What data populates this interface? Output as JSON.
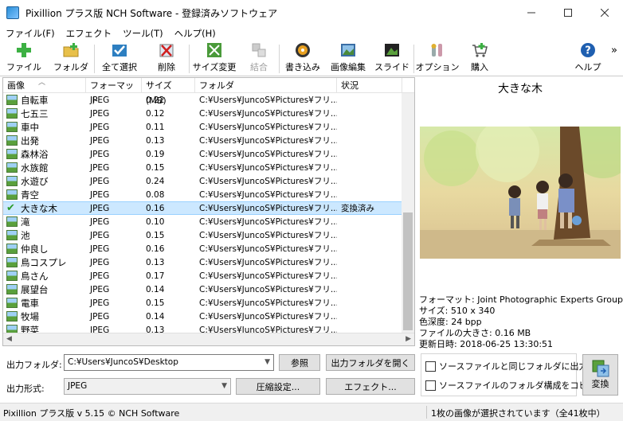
{
  "window": {
    "title": "Pixillion プラス版 NCH Software - 登録済みソフトウェア",
    "minimize_icon": "minimize-icon",
    "maximize_icon": "maximize-icon",
    "close_icon": "close-icon"
  },
  "menu": {
    "items": [
      "ファイル(F)",
      "エフェクト",
      "ツール(T)",
      "ヘルプ(H)"
    ]
  },
  "toolbar": {
    "add_file": "ファイル",
    "add_folder": "フォルダ",
    "select_all": "全て選択",
    "delete": "削除",
    "resize": "サイズ変更",
    "combine": "結合",
    "burn": "書き込み",
    "image_edit": "画像編集",
    "slide": "スライド",
    "options": "オプション",
    "buy": "購入",
    "help": "ヘルプ",
    "more": "»"
  },
  "list": {
    "columns": [
      "画像",
      "フォーマット",
      "サイズ (MB)",
      "フォルダ",
      "状況"
    ],
    "rows": [
      {
        "name": "自転車",
        "format": "JPEG",
        "size": "0.22",
        "folder": "C:¥Users¥JuncoS¥Pictures¥フリ...",
        "status": ""
      },
      {
        "name": "七五三",
        "format": "JPEG",
        "size": "0.12",
        "folder": "C:¥Users¥JuncoS¥Pictures¥フリ...",
        "status": ""
      },
      {
        "name": "車中",
        "format": "JPEG",
        "size": "0.11",
        "folder": "C:¥Users¥JuncoS¥Pictures¥フリ...",
        "status": ""
      },
      {
        "name": "出発",
        "format": "JPEG",
        "size": "0.13",
        "folder": "C:¥Users¥JuncoS¥Pictures¥フリ...",
        "status": ""
      },
      {
        "name": "森林浴",
        "format": "JPEG",
        "size": "0.19",
        "folder": "C:¥Users¥JuncoS¥Pictures¥フリ...",
        "status": ""
      },
      {
        "name": "水族館",
        "format": "JPEG",
        "size": "0.15",
        "folder": "C:¥Users¥JuncoS¥Pictures¥フリ...",
        "status": ""
      },
      {
        "name": "水遊び",
        "format": "JPEG",
        "size": "0.24",
        "folder": "C:¥Users¥JuncoS¥Pictures¥フリ...",
        "status": ""
      },
      {
        "name": "青空",
        "format": "JPEG",
        "size": "0.08",
        "folder": "C:¥Users¥JuncoS¥Pictures¥フリ...",
        "status": ""
      },
      {
        "name": "大きな木",
        "format": "JPEG",
        "size": "0.16",
        "folder": "C:¥Users¥JuncoS¥Pictures¥フリ...",
        "status": "変換済み"
      },
      {
        "name": "滝",
        "format": "JPEG",
        "size": "0.10",
        "folder": "C:¥Users¥JuncoS¥Pictures¥フリ...",
        "status": ""
      },
      {
        "name": "池",
        "format": "JPEG",
        "size": "0.15",
        "folder": "C:¥Users¥JuncoS¥Pictures¥フリ...",
        "status": ""
      },
      {
        "name": "仲良し",
        "format": "JPEG",
        "size": "0.16",
        "folder": "C:¥Users¥JuncoS¥Pictures¥フリ...",
        "status": ""
      },
      {
        "name": "鳥コスプレ",
        "format": "JPEG",
        "size": "0.13",
        "folder": "C:¥Users¥JuncoS¥Pictures¥フリ...",
        "status": ""
      },
      {
        "name": "鳥さん",
        "format": "JPEG",
        "size": "0.17",
        "folder": "C:¥Users¥JuncoS¥Pictures¥フリ...",
        "status": ""
      },
      {
        "name": "展望台",
        "format": "JPEG",
        "size": "0.14",
        "folder": "C:¥Users¥JuncoS¥Pictures¥フリ...",
        "status": ""
      },
      {
        "name": "電車",
        "format": "JPEG",
        "size": "0.15",
        "folder": "C:¥Users¥JuncoS¥Pictures¥フリ...",
        "status": ""
      },
      {
        "name": "牧場",
        "format": "JPEG",
        "size": "0.14",
        "folder": "C:¥Users¥JuncoS¥Pictures¥フリ...",
        "status": ""
      },
      {
        "name": "野菜",
        "format": "JPEG",
        "size": "0.13",
        "folder": "C:¥Users¥JuncoS¥Pictures¥フリ...",
        "status": ""
      }
    ]
  },
  "preview": {
    "title": "大きな木",
    "format": "フォーマット: Joint Photographic Experts Group",
    "dimensions": "サイズ: 510 x 340",
    "color_depth": "色深度: 24 bpp",
    "file_size": "ファイルの大きさ: 0.16 MB",
    "modified": "更新日時: 2018-06-25 13:30:51"
  },
  "output": {
    "folder_label": "出力フォルダ:",
    "folder_value": "C:¥Users¥JuncoS¥Desktop",
    "browse_label": "参照",
    "open_folder_label": "出力フォルダを開く",
    "format_label": "出力形式:",
    "format_value": "JPEG",
    "compression_label": "圧縮設定...",
    "effects_label": "エフェクト...",
    "same_folder_label": "ソースファイルと同じフォルダに出力",
    "copy_structure_label": "ソースファイルのフォルダ構成をコピー",
    "convert_label": "変換"
  },
  "status": {
    "left": "Pixillion プラス版 v 5.15 © NCH Software",
    "right": "1枚の画像が選択されています（全41枚中）"
  },
  "colors": {
    "selection": "#cce8ff",
    "check": "#2a9a2a"
  }
}
